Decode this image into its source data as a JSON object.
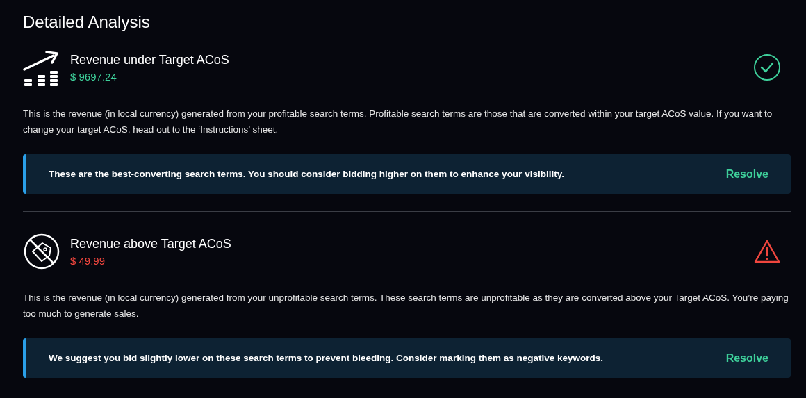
{
  "title": "Detailed Analysis",
  "sections": [
    {
      "kind": "positive",
      "heading": "Revenue under Target ACoS",
      "amount": "$ 9697.24",
      "description": "This is the revenue (in local currency) generated from your profitable search terms. Profitable search terms are those that are converted within your target ACoS value. If you want to change your target ACoS, head out to the ‘Instructions’ sheet.",
      "suggestion": "These are the best-converting search terms. You should consider bidding higher on them to enhance your visibility.",
      "action": "Resolve"
    },
    {
      "kind": "negative",
      "heading": "Revenue above Target ACoS",
      "amount": "$ 49.99",
      "description": "This is the revenue (in local currency) generated from your unprofitable search terms. These search terms are unprofitable as they are converted above your Target ACoS. You’re paying too much to generate sales.",
      "suggestion": "We suggest you bid slightly lower on these search terms to prevent bleeding. Consider marking them as negative keywords.",
      "action": "Resolve"
    }
  ]
}
